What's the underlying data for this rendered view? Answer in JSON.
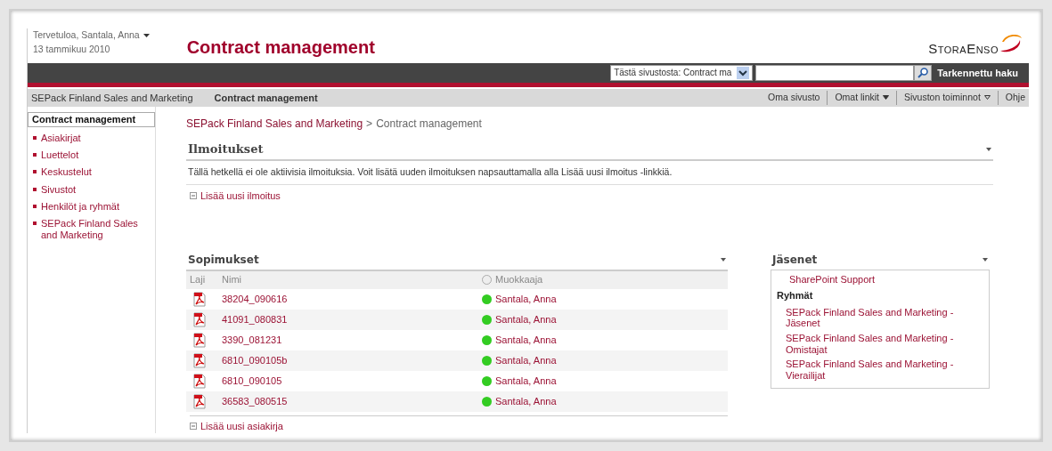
{
  "header": {
    "welcome": "Tervetuloa, Santala, Anna",
    "date": "13 tammikuu 2010",
    "title": "Contract management",
    "logo": "StoraEnso"
  },
  "search": {
    "scope": "Tästä sivustosta: Contract ma",
    "advanced": "Tarkennettu haku"
  },
  "topnav": {
    "items": [
      {
        "label": "SEPack Finland Sales and Marketing",
        "selected": false
      },
      {
        "label": "Contract management",
        "selected": true
      }
    ],
    "links": [
      {
        "label": "Oma sivusto",
        "kind": "link"
      },
      {
        "label": "Omat linkit",
        "kind": "menu"
      },
      {
        "label": "Sivuston toiminnot",
        "kind": "actions"
      },
      {
        "label": "Ohje",
        "kind": "link"
      }
    ]
  },
  "sidebar": {
    "title": "Contract management",
    "items": [
      "Asiakirjat",
      "Luettelot",
      "Keskustelut",
      "Sivustot",
      "Henkilöt ja ryhmät",
      "SEPack Finland Sales and Marketing"
    ]
  },
  "breadcrumb": {
    "items": [
      "SEPack Finland Sales and Marketing",
      "Contract management"
    ],
    "separator": ">"
  },
  "announcements": {
    "title": "Ilmoitukset",
    "message": "Tällä hetkellä ei ole aktiivisia ilmoituksia. Voit lisätä uuden ilmoituksen napsauttamalla alla Lisää uusi ilmoitus -linkkiä.",
    "add": "Lisää uusi ilmoitus"
  },
  "documents": {
    "title": "Sopimukset",
    "columns": [
      "Laji",
      "Nimi",
      "Muokkaaja"
    ],
    "rows": [
      {
        "name": "38204_090616",
        "modified_by": "Santala, Anna",
        "color": "#33cc22"
      },
      {
        "name": "41091_080831",
        "modified_by": "Santala, Anna",
        "color": "#33cc22"
      },
      {
        "name": "3390_081231",
        "modified_by": "Santala, Anna",
        "color": "#33cc22"
      },
      {
        "name": "6810_090105b",
        "modified_by": "Santala, Anna",
        "color": "#33cc22"
      },
      {
        "name": "6810_090105",
        "modified_by": "Santala, Anna",
        "color": "#33cc22"
      },
      {
        "name": "36583_080515",
        "modified_by": "Santala, Anna",
        "color": "#33cc22"
      }
    ],
    "add": "Lisää uusi asiakirja"
  },
  "members": {
    "title": "Jäsenet",
    "people": [
      "SharePoint Support"
    ],
    "groups_title": "Ryhmät",
    "groups": [
      "SEPack Finland Sales and Marketing - Jäsenet",
      "SEPack Finland Sales and Marketing - Omistajat",
      "SEPack Finland Sales and Marketing - Vierailijat"
    ]
  }
}
